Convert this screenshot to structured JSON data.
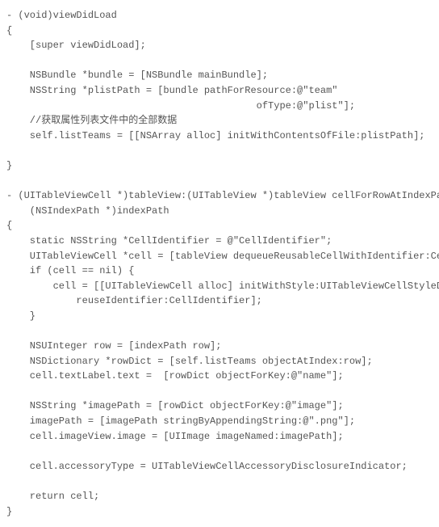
{
  "code": {
    "lines": [
      "- (void)viewDidLoad",
      "{",
      "    [super viewDidLoad];",
      "",
      "    NSBundle *bundle = [NSBundle mainBundle];",
      "    NSString *plistPath = [bundle pathForResource:@\"team\"",
      "                                           ofType:@\"plist\"];",
      "    //获取属性列表文件中的全部数据",
      "    self.listTeams = [[NSArray alloc] initWithContentsOfFile:plistPath];",
      "",
      "}",
      "",
      "- (UITableViewCell *)tableView:(UITableView *)tableView cellForRowAtIndexPath:",
      "    (NSIndexPath *)indexPath",
      "{",
      "    static NSString *CellIdentifier = @\"CellIdentifier\";",
      "    UITableViewCell *cell = [tableView dequeueReusableCellWithIdentifier:CellIdentifier];",
      "    if (cell == nil) {",
      "        cell = [[UITableViewCell alloc] initWithStyle:UITableViewCellStyleDefault",
      "            reuseIdentifier:CellIdentifier];",
      "    }",
      "",
      "    NSUInteger row = [indexPath row];",
      "    NSDictionary *rowDict = [self.listTeams objectAtIndex:row];",
      "    cell.textLabel.text =  [rowDict objectForKey:@\"name\"];",
      "",
      "    NSString *imagePath = [rowDict objectForKey:@\"image\"];",
      "    imagePath = [imagePath stringByAppendingString:@\".png\"];",
      "    cell.imageView.image = [UIImage imageNamed:imagePath];",
      "",
      "    cell.accessoryType = UITableViewCellAccessoryDisclosureIndicator;",
      "",
      "    return cell;",
      "}"
    ]
  }
}
